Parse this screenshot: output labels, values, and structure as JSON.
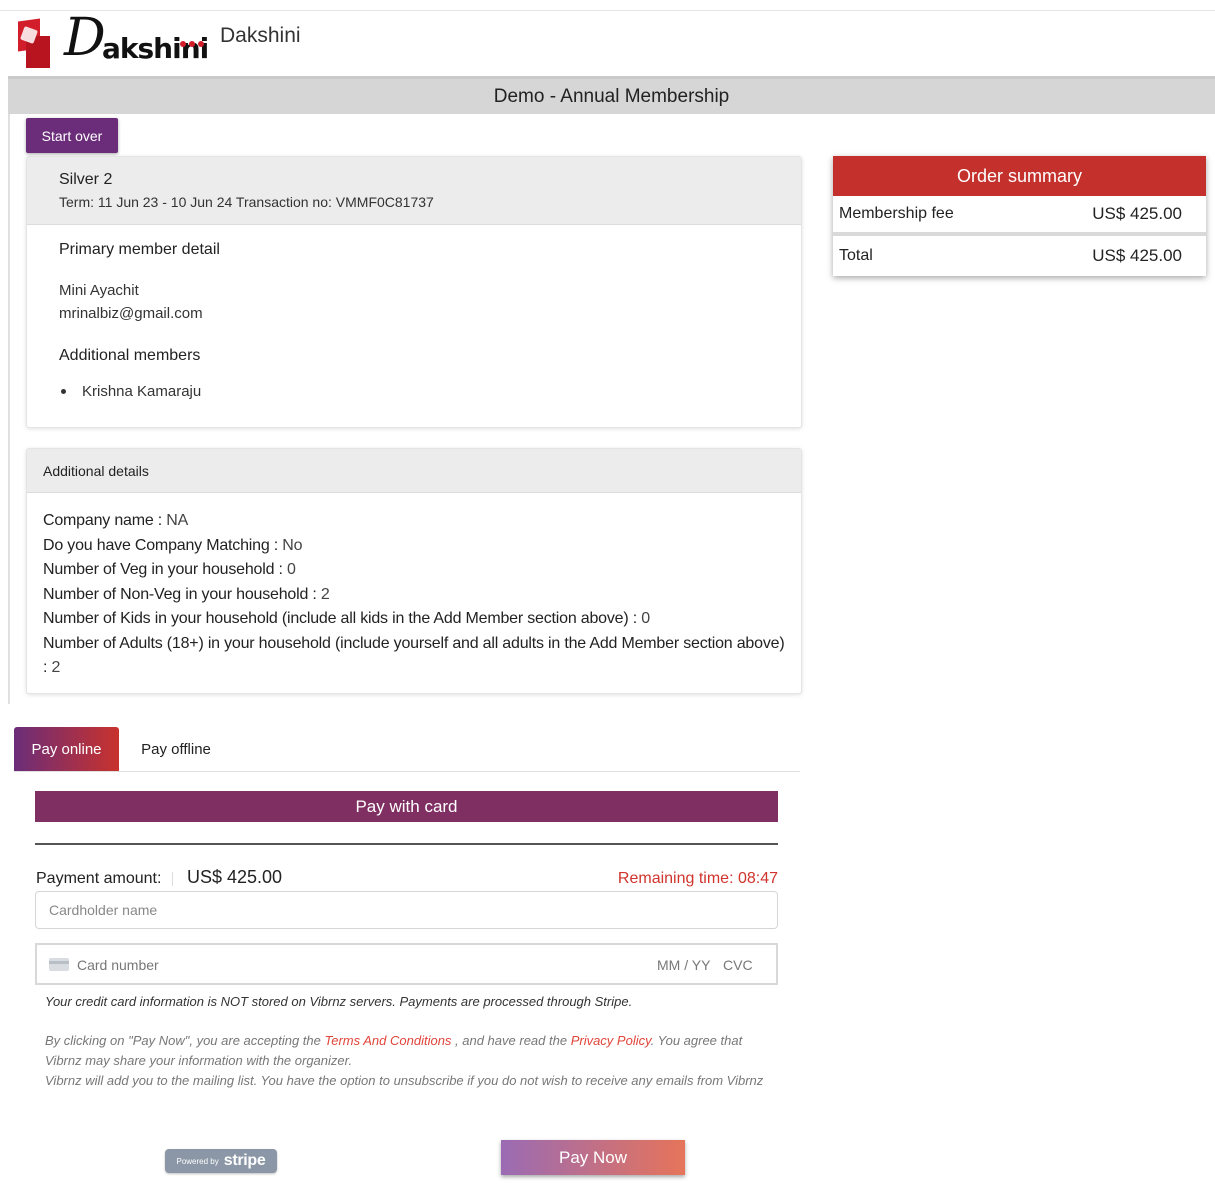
{
  "brand": {
    "logo_initial": "D",
    "logo_text": "akshini",
    "name": "Dakshini"
  },
  "page_title": "Demo - Annual Membership",
  "start_over_label": "Start over",
  "membership": {
    "plan_name": "Silver 2",
    "term_line": "Term: 11 Jun 23 - 10 Jun 24 Transaction no: VMMF0C81737",
    "primary_title": "Primary member detail",
    "primary_name": "Mini Ayachit",
    "primary_email": "mrinalbiz@gmail.com",
    "additional_title": "Additional members",
    "additional_members": [
      "Krishna Kamaraju"
    ]
  },
  "additional_details": {
    "title": "Additional details",
    "items": [
      {
        "label": "Company name : ",
        "value": "NA"
      },
      {
        "label": "Do you have Company Matching : ",
        "value": "No"
      },
      {
        "label": "Number of Veg in your household : ",
        "value": "0"
      },
      {
        "label": "Number of Non-Veg in your household : ",
        "value": "2"
      },
      {
        "label": "Number of Kids in your household (include all kids in the Add Member section above) : ",
        "value": "0"
      },
      {
        "label": "Number of Adults (18+) in your household (include yourself and all adults in the Add Member section above) : ",
        "value": "2"
      }
    ]
  },
  "order_summary": {
    "title": "Order summary",
    "rows": [
      {
        "label": "Membership fee",
        "amount": "US$ 425.00"
      },
      {
        "label": "Total",
        "amount": "US$ 425.00"
      }
    ]
  },
  "tabs": {
    "online": "Pay online",
    "offline": "Pay offline"
  },
  "payment": {
    "header": "Pay with card",
    "amount_label": "Payment amount:",
    "amount_value": "US$ 425.00",
    "remaining": "Remaining time: 08:47",
    "cardholder_placeholder": "Cardholder name",
    "card_number_placeholder": "Card number",
    "exp_placeholder": "MM / YY",
    "cvc_placeholder": "CVC",
    "secure_note": "Your credit card information is NOT stored on Vibrnz servers. Payments are processed through Stripe.",
    "terms_prefix": "By clicking on \"Pay Now\", you are accepting the ",
    "terms_link": "Terms And Conditions",
    "terms_middle": " , and have read the ",
    "privacy_link": "Privacy Policy",
    "terms_suffix": ". You agree that Vibrnz may share your information with the organizer.",
    "mailing_note": "Vibrnz will add you to the mailing list. You have the option to unsubscribe if you do not wish to receive any emails from Vibrnz",
    "stripe_powered": "Powered by",
    "stripe_name": "stripe",
    "pay_now_label": "Pay Now"
  },
  "colors": {
    "accent_purple": "#6b2d79",
    "order_red": "#c4302b",
    "remaining_red": "#d0342c"
  }
}
